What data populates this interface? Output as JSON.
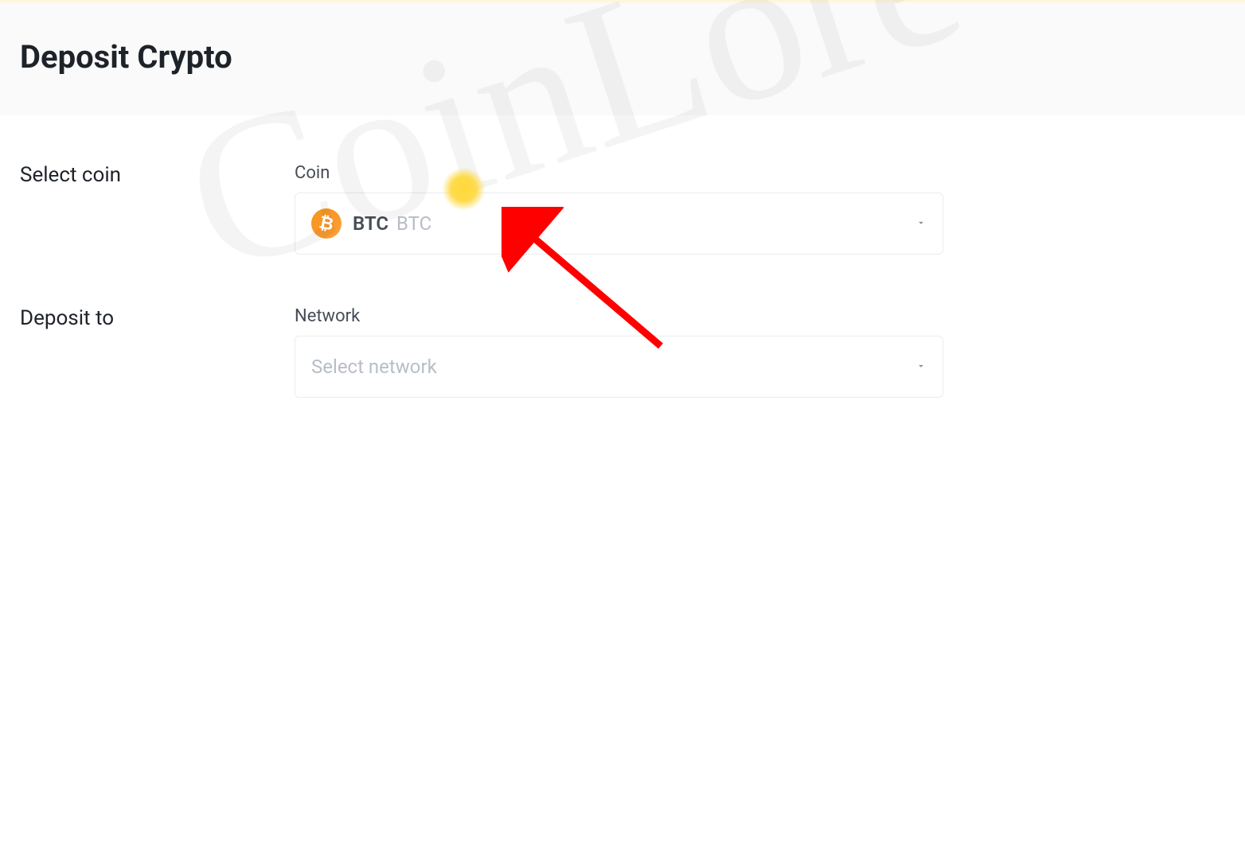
{
  "header": {
    "title": "Deposit Crypto"
  },
  "form": {
    "selectCoin": {
      "label": "Select coin",
      "fieldLabel": "Coin",
      "selected": {
        "icon": "bitcoin-icon",
        "ticker": "BTC",
        "name": "BTC"
      }
    },
    "depositTo": {
      "label": "Deposit to",
      "fieldLabel": "Network",
      "placeholder": "Select network"
    }
  },
  "watermark": "CoinLore"
}
